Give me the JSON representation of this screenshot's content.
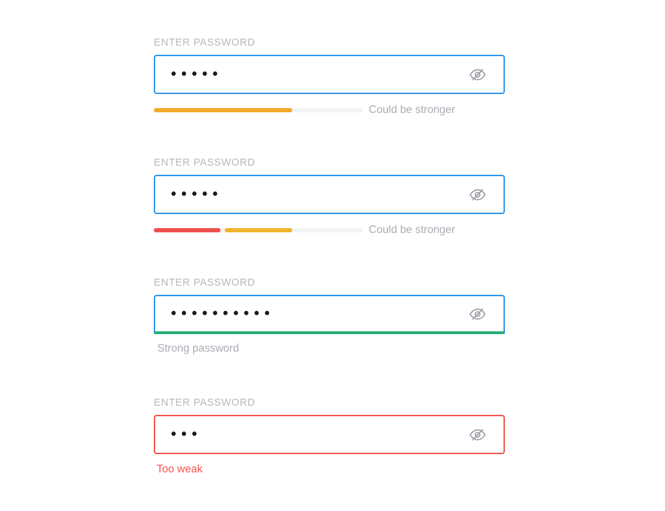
{
  "fields": [
    {
      "label": "ENTER PASSWORD",
      "masked_value": "•••••",
      "character_count": 5,
      "border_state": "focus-blue",
      "border_color": "#2f96ea",
      "toggle_icon": "eye-slash-icon",
      "indicator_type": "segmented-bar",
      "caption": "Could be stronger",
      "caption_color": "#a9adb3",
      "segments": [
        {
          "name": "filled",
          "start_pct": 0,
          "width_pct": 66,
          "color": "#f3a82a"
        }
      ],
      "track_color": "#f2f3f5"
    },
    {
      "label": "ENTER PASSWORD",
      "masked_value": "•••••",
      "character_count": 5,
      "border_state": "focus-blue",
      "border_color": "#2f96ea",
      "toggle_icon": "eye-slash-icon",
      "indicator_type": "segmented-bar",
      "caption": "Could be stronger",
      "caption_color": "#a9adb3",
      "segments": [
        {
          "name": "weak",
          "start_pct": 0,
          "width_pct": 32,
          "color": "#ef4f4f"
        },
        {
          "name": "medium",
          "start_pct": 34,
          "width_pct": 32,
          "color": "#f0b32c"
        }
      ],
      "track_color": "#f2f3f5"
    },
    {
      "label": "ENTER PASSWORD",
      "masked_value": "••••••••••",
      "character_count": 10,
      "border_state": "focus-blue-strong-underline",
      "border_color": "#2f96ea",
      "underline_color": "#27ae76",
      "toggle_icon": "eye-slash-icon",
      "indicator_type": "underline",
      "caption": "Strong password",
      "caption_color": "#a9adb3"
    },
    {
      "label": "ENTER PASSWORD",
      "masked_value": "•••",
      "character_count": 3,
      "border_state": "error-red",
      "border_color": "#f2564e",
      "toggle_icon": "eye-slash-icon",
      "indicator_type": "none",
      "caption": "Too weak",
      "caption_color": "#f2564e"
    }
  ]
}
